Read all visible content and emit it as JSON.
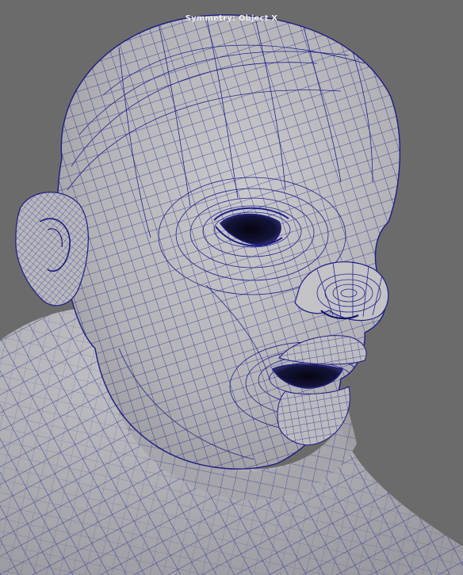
{
  "viewport": {
    "hud_label": "Symmetry: Object X",
    "background_color": "#6b6b6b",
    "mesh_surface_color": "#b9b9bd",
    "wireframe_color": "#1a1a8a"
  }
}
